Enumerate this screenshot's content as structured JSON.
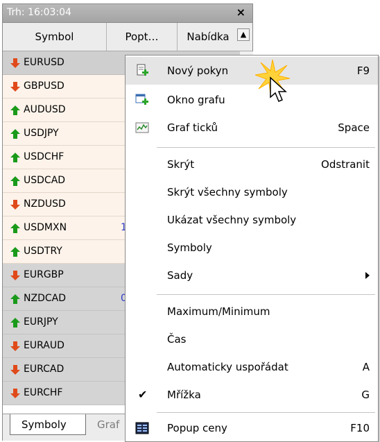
{
  "window": {
    "title": "Trh: 16:03:04",
    "close_glyph": "×"
  },
  "columns": {
    "symbol": "Symbol",
    "bid": "Popt…",
    "ask": "Nabídka"
  },
  "rows": [
    {
      "symbol": "EURUSD",
      "dir": "down",
      "bid": ""
    },
    {
      "symbol": "GBPUSD",
      "dir": "down",
      "bid": ""
    },
    {
      "symbol": "AUDUSD",
      "dir": "up",
      "bid": ""
    },
    {
      "symbol": "USDJPY",
      "dir": "up",
      "bid": ""
    },
    {
      "symbol": "USDCHF",
      "dir": "up",
      "bid": ""
    },
    {
      "symbol": "USDCAD",
      "dir": "up",
      "bid": ""
    },
    {
      "symbol": "NZDUSD",
      "dir": "down",
      "bid": ""
    },
    {
      "symbol": "USDMXN",
      "dir": "up",
      "bid": "1"
    },
    {
      "symbol": "USDTRY",
      "dir": "up",
      "bid": ""
    },
    {
      "symbol": "EURGBP",
      "dir": "down",
      "bid": ""
    },
    {
      "symbol": "NZDCAD",
      "dir": "up",
      "bid": "0"
    },
    {
      "symbol": "EURJPY",
      "dir": "up",
      "bid": ""
    },
    {
      "symbol": "EURAUD",
      "dir": "down",
      "bid": ""
    },
    {
      "symbol": "EURCAD",
      "dir": "down",
      "bid": ""
    },
    {
      "symbol": "EURCHF",
      "dir": "down",
      "bid": ""
    }
  ],
  "tabs": {
    "active": "Symboly",
    "inactive": "Graf"
  },
  "menu": {
    "new_order": {
      "label": "Nový pokyn",
      "shortcut": "F9"
    },
    "chart_window": {
      "label": "Okno grafu"
    },
    "tick_chart": {
      "label": "Graf ticků",
      "shortcut": "Space"
    },
    "hide": {
      "label": "Skrýt",
      "shortcut": "Odstranit"
    },
    "hide_all": {
      "label": "Skrýt všechny symboly"
    },
    "show_all": {
      "label": "Ukázat všechny symboly"
    },
    "symbols": {
      "label": "Symboly"
    },
    "sets": {
      "label": "Sady"
    },
    "high_low": {
      "label": "Maximum/Minimum"
    },
    "time": {
      "label": "Čas"
    },
    "auto_arrange": {
      "label": "Automaticky uspořádat",
      "shortcut": "A"
    },
    "grid": {
      "label": "Mřížka",
      "shortcut": "G",
      "checked": true
    },
    "popup_prices": {
      "label": "Popup ceny",
      "shortcut": "F10"
    }
  },
  "colors": {
    "up_arrow": "#1a9a1a",
    "down_arrow": "#e04a1a",
    "bid_text": "#2b37c8"
  }
}
